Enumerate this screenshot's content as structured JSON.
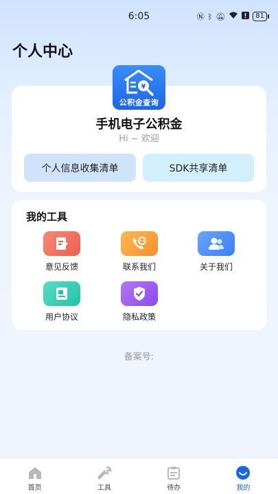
{
  "status_bar": {
    "time": "6:05",
    "battery": "81"
  },
  "page_title": "个人中心",
  "profile": {
    "logo_caption": "公积金查询",
    "app_name": "手机电子公积金",
    "greeting": "Hi ~ 欢迎",
    "buttons": [
      "个人信息收集清单",
      "SDK共享清单"
    ]
  },
  "tools": {
    "title": "我的工具",
    "items": [
      {
        "label": "意见反馈",
        "icon": "feedback-icon",
        "color": "#f06b5b"
      },
      {
        "label": "联系我们",
        "icon": "phone-icon",
        "color": "#f9a23a"
      },
      {
        "label": "关于我们",
        "icon": "users-icon",
        "color": "#4d8ef7"
      },
      {
        "label": "用户协议",
        "icon": "document-icon",
        "color": "#2fcfb4"
      },
      {
        "label": "隐私政策",
        "icon": "shield-icon",
        "color": "#9a57ee"
      }
    ]
  },
  "record_no": "备案号:",
  "tabbar": {
    "items": [
      {
        "label": "首页",
        "icon": "home-icon",
        "active": false
      },
      {
        "label": "工具",
        "icon": "wrench-icon",
        "active": false
      },
      {
        "label": "待办",
        "icon": "clipboard-icon",
        "active": false
      },
      {
        "label": "我的",
        "icon": "profile-icon",
        "active": true
      }
    ],
    "accent": "#1a66e8"
  }
}
